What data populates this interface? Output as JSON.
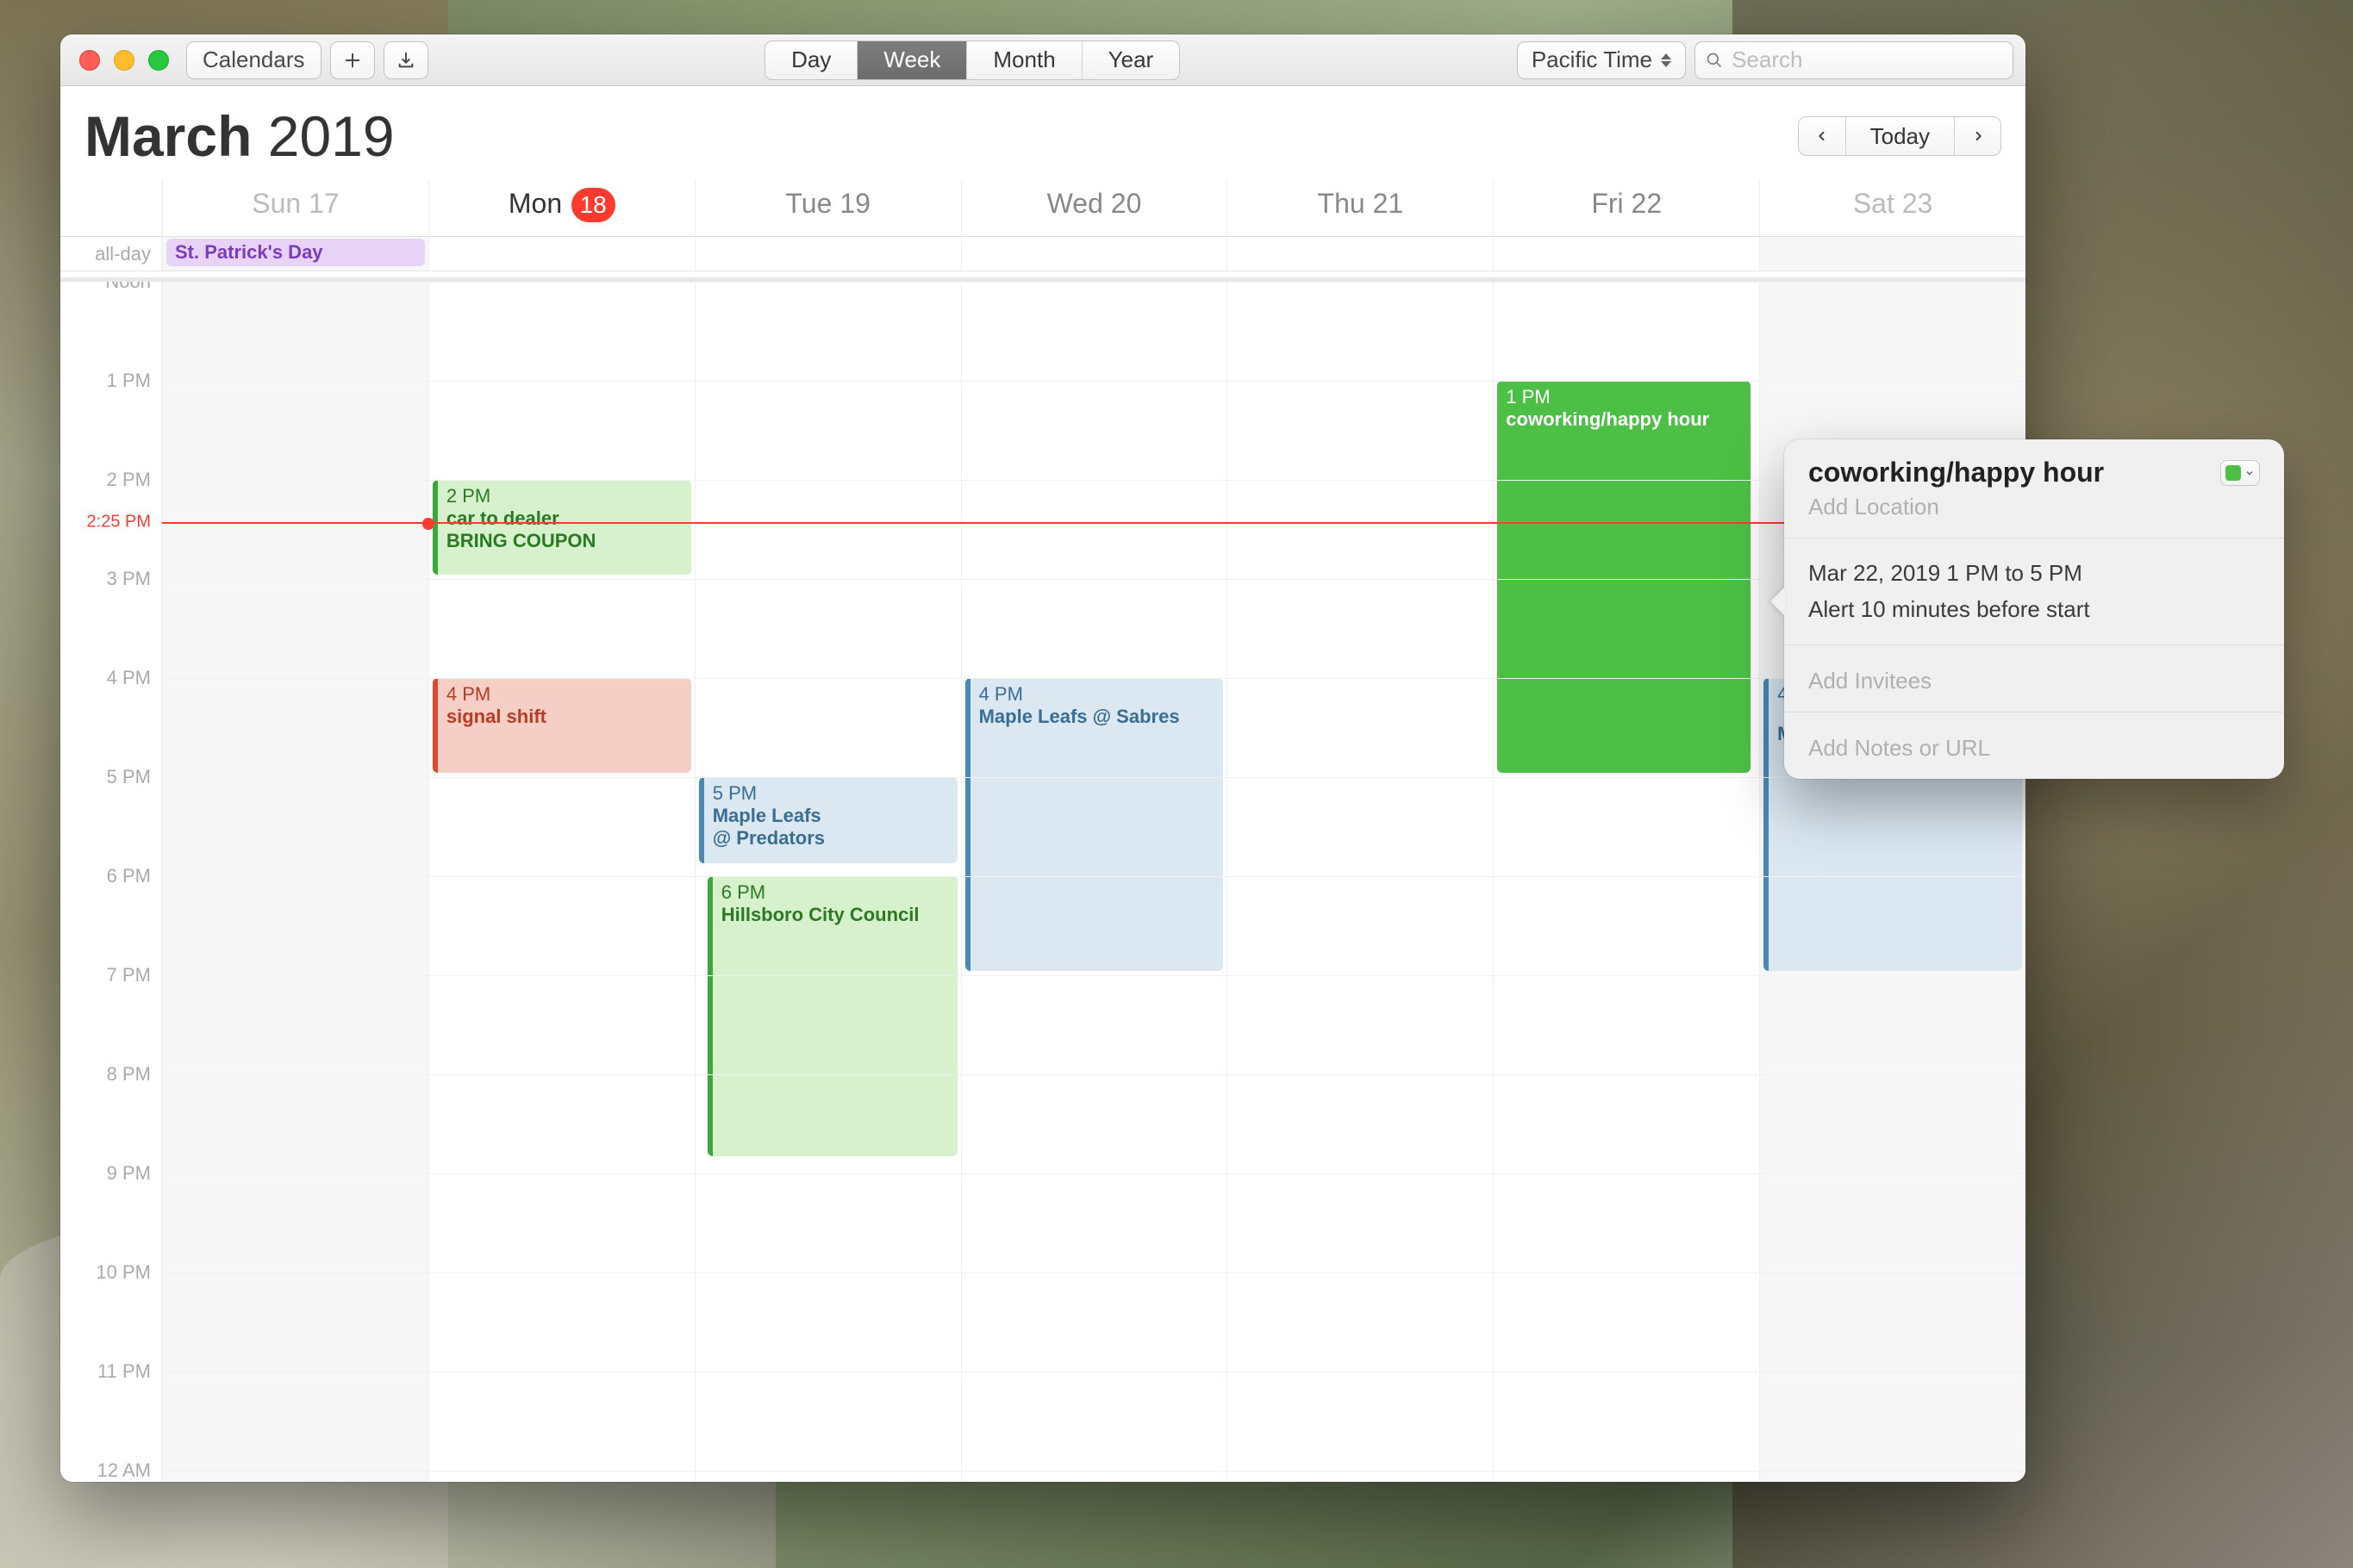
{
  "toolbar": {
    "calendars_label": "Calendars",
    "timezone": "Pacific Time",
    "views": {
      "day": "Day",
      "week": "Week",
      "month": "Month",
      "year": "Year",
      "active": "Week"
    },
    "today": "Today"
  },
  "search": {
    "placeholder": "Search"
  },
  "header": {
    "month": "March",
    "year": "2019"
  },
  "days": [
    {
      "label": "Sun 17",
      "weekend": true
    },
    {
      "label": "Mon",
      "num": "18",
      "today": true
    },
    {
      "label": "Tue 19"
    },
    {
      "label": "Wed 20"
    },
    {
      "label": "Thu 21"
    },
    {
      "label": "Fri 22"
    },
    {
      "label": "Sat 23",
      "weekend": true
    }
  ],
  "allday": {
    "gutter": "all-day",
    "sun": "St. Patrick's Day"
  },
  "hours": [
    "Noon",
    "1 PM",
    "2 PM",
    "3 PM",
    "4 PM",
    "5 PM",
    "6 PM",
    "7 PM",
    "8 PM",
    "9 PM",
    "10 PM",
    "11 PM",
    "12 AM"
  ],
  "now": {
    "label": "2:25 PM"
  },
  "events": {
    "mon_car": {
      "time": "2 PM",
      "title": "car to dealer",
      "sub": "BRING COUPON"
    },
    "mon_signal": {
      "time": "4 PM",
      "title": "signal shift"
    },
    "tue_leafs": {
      "time": "5 PM",
      "title": "Maple Leafs",
      "sub": "@ Predators"
    },
    "tue_council": {
      "time": "6 PM",
      "title": "Hillsboro City Council"
    },
    "wed_leafs": {
      "time": "4 PM",
      "title": "Maple Leafs @ Sabres"
    },
    "fri_cowork": {
      "time": "1 PM",
      "title": "coworking/happy hour"
    },
    "sat_leafs": {
      "time": "4",
      "title": "Maple Leafs"
    }
  },
  "popover": {
    "title": "coworking/happy hour",
    "location_ph": "Add Location",
    "date_line": "Mar 22, 2019  1 PM to 5 PM",
    "alert_line": "Alert 10 minutes before start",
    "invitees_ph": "Add Invitees",
    "notes_ph": "Add Notes or URL"
  }
}
